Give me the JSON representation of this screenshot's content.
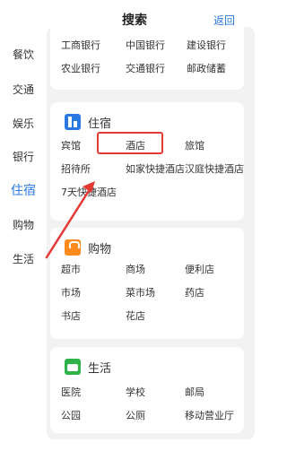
{
  "header": {
    "title": "搜索",
    "back_label": "返回"
  },
  "sidebar": {
    "items": [
      {
        "label": "餐饮"
      },
      {
        "label": "交通"
      },
      {
        "label": "娱乐"
      },
      {
        "label": "银行"
      },
      {
        "label": "住宿"
      },
      {
        "label": "购物"
      },
      {
        "label": "生活"
      }
    ],
    "active_index": 4
  },
  "sections": {
    "bank": {
      "items": [
        "工商银行",
        "中国银行",
        "建设银行",
        "农业银行",
        "交通银行",
        "邮政储蓄"
      ]
    },
    "lodging": {
      "title": "住宿",
      "items": [
        "宾馆",
        "酒店",
        "旅馆",
        "招待所",
        "如家快捷酒店",
        "汉庭快捷酒店",
        "7天快捷酒店"
      ],
      "highlighted": "酒店"
    },
    "shopping": {
      "title": "购物",
      "items": [
        "超市",
        "商场",
        "便利店",
        "市场",
        "菜市场",
        "药店",
        "书店",
        "花店"
      ]
    },
    "life": {
      "title": "生活",
      "items": [
        "医院",
        "学校",
        "邮局",
        "公园",
        "公厕",
        "移动营业厅"
      ]
    }
  },
  "colors": {
    "accent": "#2a7ae2",
    "highlight": "#e53935",
    "shop_icon": "#ff8a1d",
    "life_icon": "#2fb24a"
  }
}
